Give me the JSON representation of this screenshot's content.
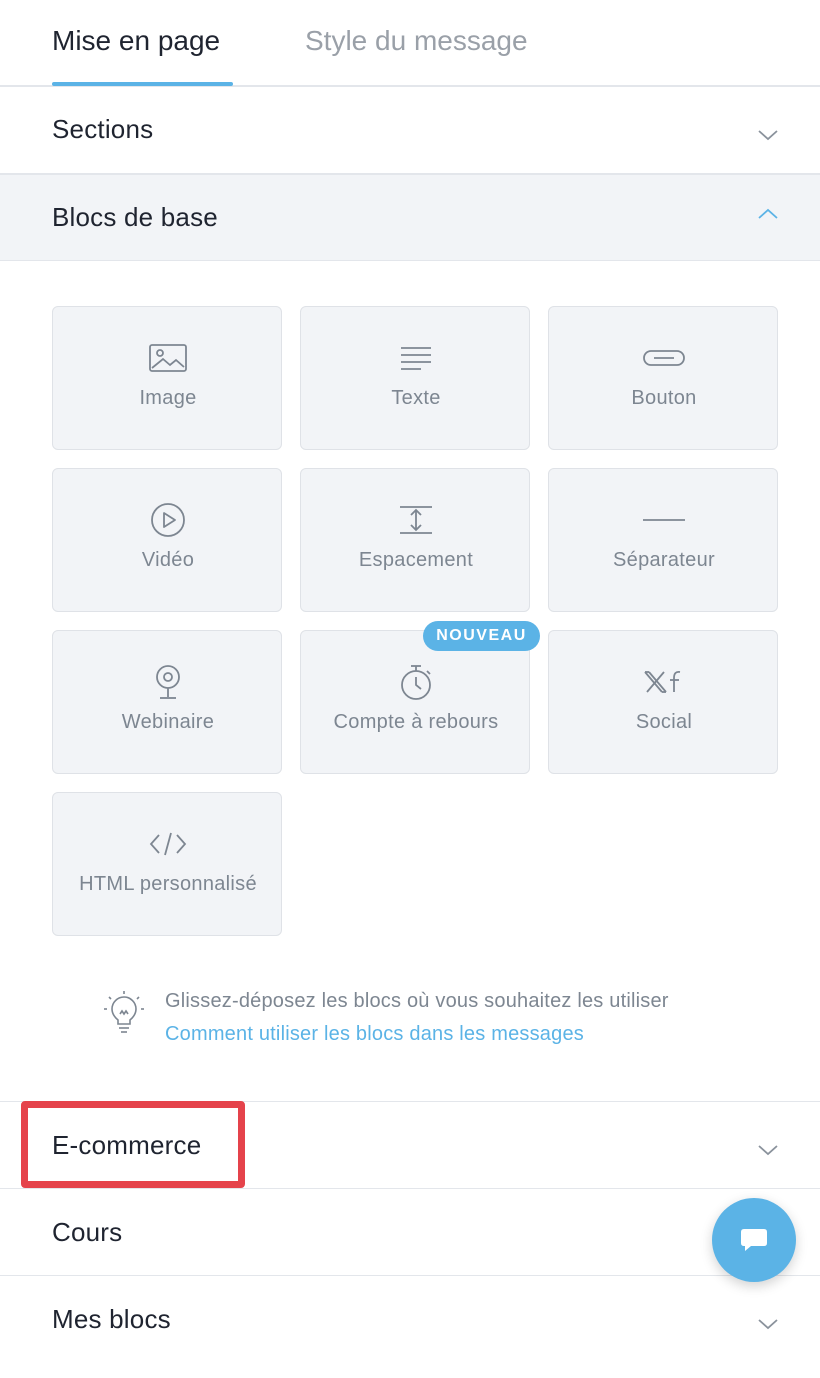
{
  "tabs": {
    "layout": "Mise en page",
    "message_style": "Style du message"
  },
  "accordion": {
    "sections": "Sections",
    "basic_blocks": "Blocs de base",
    "ecommerce": "E-commerce",
    "courses": "Cours",
    "my_blocks": "Mes blocs"
  },
  "blocks": [
    {
      "label": "Image",
      "icon": "image-icon"
    },
    {
      "label": "Texte",
      "icon": "text-icon"
    },
    {
      "label": "Bouton",
      "icon": "button-icon"
    },
    {
      "label": "Vidéo",
      "icon": "video-icon"
    },
    {
      "label": "Espacement",
      "icon": "spacing-icon"
    },
    {
      "label": "Séparateur",
      "icon": "separator-icon"
    },
    {
      "label": "Webinaire",
      "icon": "webinar-icon"
    },
    {
      "label": "Compte à rebours",
      "icon": "timer-icon"
    },
    {
      "label": "Social",
      "icon": "social-icon"
    },
    {
      "label": "HTML personnalisé",
      "icon": "code-icon"
    }
  ],
  "badge": "NOUVEAU",
  "hint": {
    "text": "Glissez-déposez les blocs où vous souhaitez les utiliser",
    "link": "Comment utiliser les blocs dans les messages",
    "icon": "lightbulb-icon"
  },
  "colors": {
    "accent": "#5bb3e6",
    "highlight": "#e5434b",
    "tile_bg": "#f2f4f7",
    "muted_text": "#7d8691"
  }
}
